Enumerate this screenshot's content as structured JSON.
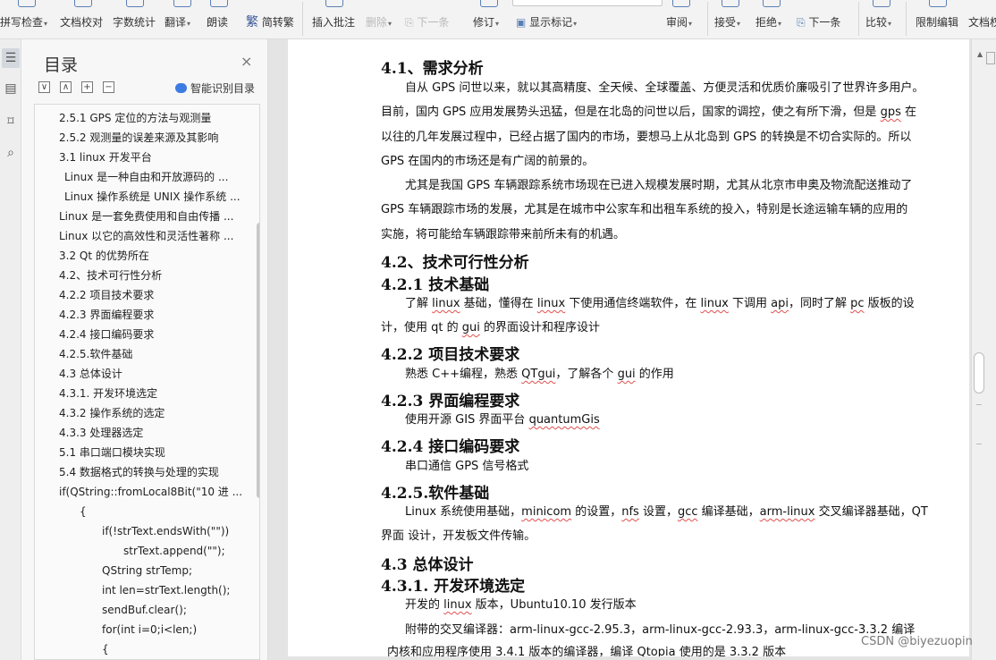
{
  "ribbon": {
    "spell_check": "拼写检查",
    "doc_proof": "文档校对",
    "word_count": "字数统计",
    "translate": "翻译",
    "read_aloud": "朗读",
    "simp_trad": "简转繁",
    "trad_glyph": "繁",
    "insert_comment": "插入批注",
    "delete": "删除",
    "next_item": "下一条",
    "revise": "修订",
    "show_marks": "显示标记",
    "review": "审阅",
    "accept": "接受",
    "reject": "拒绝",
    "next_change": "下一条",
    "compare": "比较",
    "restrict_edit": "限制编辑",
    "doc_rights": "文档权"
  },
  "toc": {
    "title": "目录",
    "close": "×",
    "smart_recognize": "智能识别目录",
    "tools": [
      "∨",
      "∧",
      "+",
      "−"
    ],
    "items": [
      "2.5.1 GPS  定位的方法与观测量",
      "2.5.2  观测量的误差来源及其影响",
      "3.1 linux 开发平台",
      "Linux 是一种自由和开放源码的 ...",
      "Linux 操作系统是 UNIX 操作系统 ...",
      "Linux 是一套免费使用和自由传播 ...",
      "Linux 以它的高效性和灵活性著称 ...",
      "3.2 Qt 的优势所在",
      "4.2、技术可行性分析",
      "4.2.2  项目技术要求",
      "4.2.3  界面编程要求",
      "4.2.4 接口编码要求",
      "4.2.5.软件基础",
      "4.3  总体设计",
      "4.3.1.  开发环境选定",
      "4.3.2 操作系统的选定",
      "4.3.3 处理器选定",
      "5.1 串口端口模块实现",
      "5.4 数据格式的转换与处理的实现",
      "if(QString::fromLocal8Bit(\"10 进 ...",
      "{",
      "if(!strText.endsWith(\"\"))",
      "strText.append(\"\");",
      "QString strTemp;",
      "int len=strText.length();",
      "sendBuf.clear();",
      "for(int i=0;i<len;)",
      "{"
    ]
  },
  "doc": {
    "h_41": "4.1、需求分析",
    "p1_l1": "自从 GPS 问世以来，就以其高精度、全天候、全球覆盖、方便灵活和优质价廉吸引了世界许多用户。",
    "p1_l2a": "目前，国内 GPS 应用发展势头迅猛，但是在北岛的问世以后，国家的调控，使之有所下滑，但是 ",
    "p1_l2b": "gps",
    "p1_l2c": " 在",
    "p1_l3": "以往的几年发展过程中，已经占据了国内的市场，要想马上从北岛到 GPS 的转换是不切合实际的。所以",
    "p1_l4": "GPS 在国内的市场还是有广阔的前景的。",
    "p2_l1": "尤其是我国 GPS 车辆跟踪系统市场现在已进入规模发展时期，尤其从北京市申奥及物流配送推动了",
    "p2_l2": "GPS 车辆跟踪市场的发展，尤其是在城市中公家车和出租车系统的投入，特别是长途运输车辆的应用的",
    "p2_l3": "实施，将可能给车辆跟踪带来前所未有的机遇。",
    "h_42": "4.2、技术可行性分析",
    "h_421": "4.2.1  技术基础",
    "p3_l1a": "了解 ",
    "p3_l1b": "linux",
    "p3_l1c": " 基础，懂得在 ",
    "p3_l1d": "linux",
    "p3_l1e": " 下使用通信终端软件，在 ",
    "p3_l1f": "linux",
    "p3_l1g": " 下调用 ",
    "p3_l1h": "api",
    "p3_l1i": "，同时了解 ",
    "p3_l1j": "pc",
    "p3_l1k": " 版板的设",
    "p3_l2a": "计，使用 qt 的 ",
    "p3_l2b": "gui",
    "p3_l2c": " 的界面设计和程序设计",
    "h_422": "4.2.2  项目技术要求",
    "p4a": "熟悉 C++编程，熟悉 ",
    "p4b": "QTgui",
    "p4c": "，了解各个 ",
    "p4d": "gui",
    "p4e": " 的作用",
    "h_423": "4.2.3  界面编程要求",
    "p5a": "使用开源 GIS 界面平台 ",
    "p5b": "quantumGis",
    "h_424": "4.2.4 接口编码要求",
    "p6": "串口通信   GPS 信号格式",
    "h_425": "4.2.5.软件基础",
    "p7_l1a": "Linux 系统使用基础，",
    "p7_l1b": "minicom",
    "p7_l1c": " 的设置，",
    "p7_l1d": "nfs",
    "p7_l1e": " 设置，",
    "p7_l1f": "gcc",
    "p7_l1g": " 编译基础，",
    "p7_l1h": "arm-linux",
    "p7_l1i": " 交叉编译器基础，QT",
    "p7_l2": "界面  设计，开发板文件传输。",
    "h_43": "4.3  总体设计",
    "h_431": "4.3.1.  开发环境选定",
    "p8a": "开发的 ",
    "p8b": "linux",
    "p8c": " 版本，Ubuntu10.10 发行版本",
    "p9": "附带的交叉编译器：arm-linux-gcc-2.95.3，arm-linux-gcc-2.93.3，arm-linux-gcc-3.3.2 编译",
    "p10": "内核和应用程序使用 3.4.1 版本的编译器，编译 Qtopia 使用的是 3.3.2 版本"
  },
  "watermark": "CSDN @biyezuopin"
}
